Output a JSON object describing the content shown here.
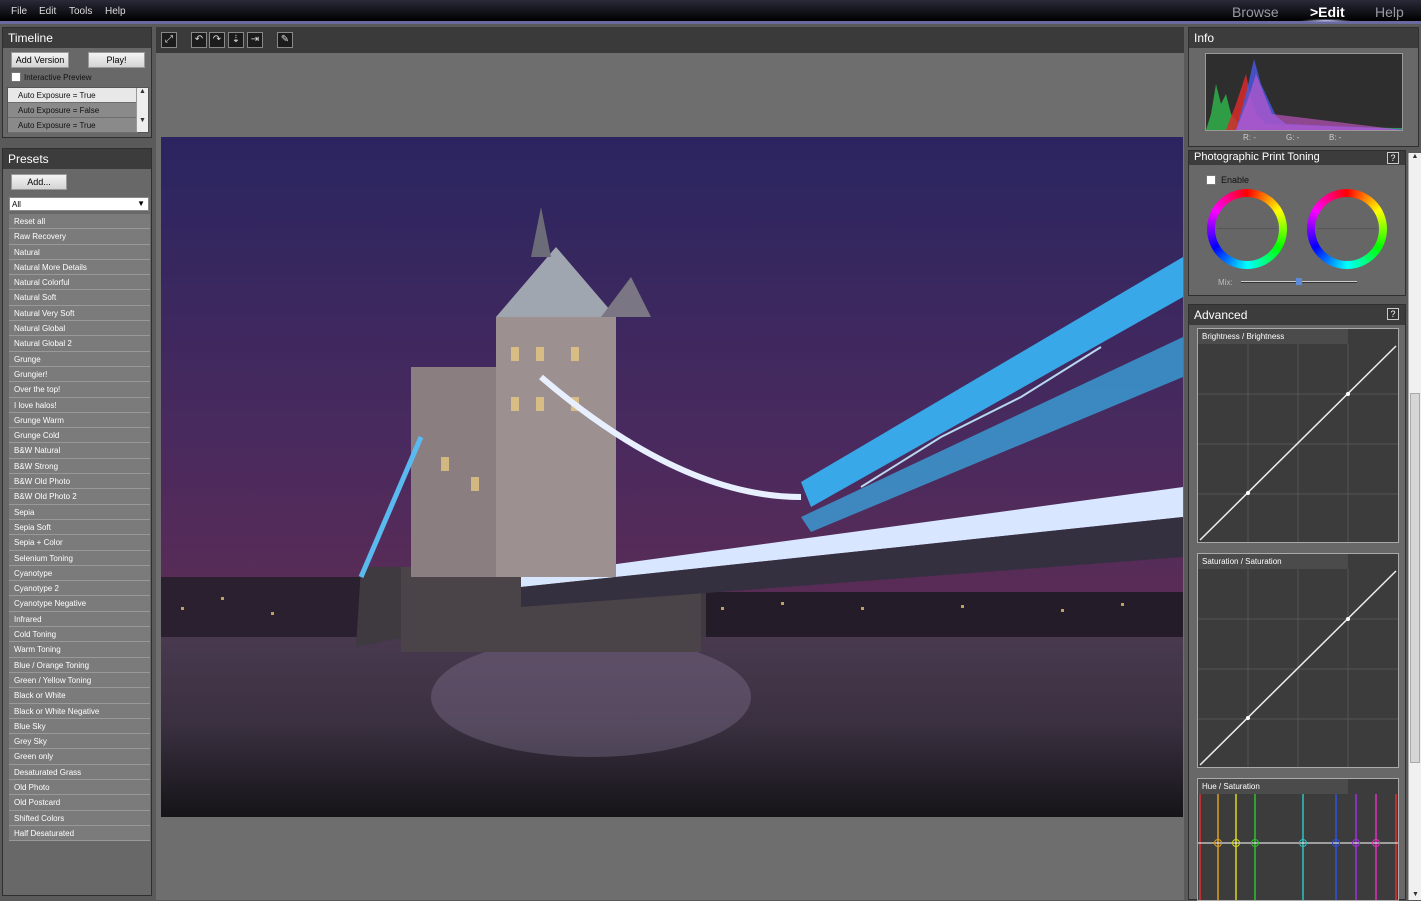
{
  "menu": {
    "file": "File",
    "edit": "Edit",
    "tools": "Tools",
    "help": "Help"
  },
  "nav": {
    "browse": "Browse",
    "edit": ">Edit",
    "help": "Help"
  },
  "timeline": {
    "title": "Timeline",
    "add_version": "Add Version",
    "play": "Play!",
    "interactive_preview": "Interactive Preview",
    "items": [
      "Auto Exposure = True",
      "Auto Exposure = False",
      "Auto Exposure = True"
    ]
  },
  "presets": {
    "title": "Presets",
    "add": "Add...",
    "filter": "All",
    "items": [
      "Reset all",
      "Raw Recovery",
      "Natural",
      "Natural More Details",
      "Natural Colorful",
      "Natural Soft",
      "Natural Very Soft",
      "Natural Global",
      "Natural Global 2",
      "Grunge",
      "Grungier!",
      "Over the top!",
      "I love halos!",
      "Grunge Warm",
      "Grunge Cold",
      "B&W Natural",
      "B&W Strong",
      "B&W Old Photo",
      "B&W Old Photo 2",
      "Sepia",
      "Sepia Soft",
      "Sepia + Color",
      "Selenium Toning",
      "Cyanotype",
      "Cyanotype 2",
      "Cyanotype Negative",
      "Infrared",
      "Cold Toning",
      "Warm Toning",
      "Blue / Orange Toning",
      "Green / Yellow Toning",
      "Black or White",
      "Black or White Negative",
      "Blue Sky",
      "Grey Sky",
      "Green only",
      "Desaturated Grass",
      "Old Photo",
      "Old Postcard",
      "Shifted Colors",
      "Half Desaturated"
    ]
  },
  "info": {
    "title": "Info",
    "r": "R: -",
    "g": "G: -",
    "b": "B: -"
  },
  "toning": {
    "title": "Photographic Print Toning",
    "help": "?",
    "enable": "Enable",
    "mix": "Mix:",
    "mix_value": 0.5
  },
  "advanced": {
    "title": "Advanced",
    "help": "?",
    "curves": [
      "Brightness / Brightness",
      "Saturation / Saturation",
      "Hue / Saturation"
    ]
  },
  "colors": {
    "accent": "#6a6aa0",
    "panel": "#686868",
    "title_bar": "#3c3c3c"
  }
}
